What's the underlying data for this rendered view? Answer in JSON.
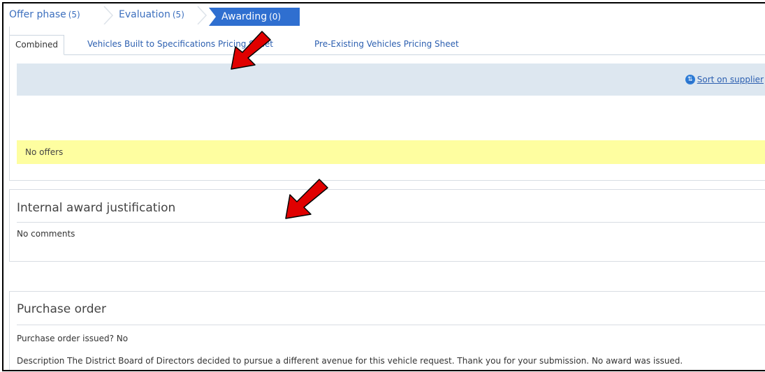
{
  "phases": [
    {
      "label": "Offer phase",
      "count": "(5)"
    },
    {
      "label": "Evaluation",
      "count": "(5)"
    },
    {
      "label": "Awarding",
      "count": "(0)"
    }
  ],
  "tabs": [
    {
      "label": "Combined"
    },
    {
      "label": "Vehicles Built to Specifications Pricing Sheet"
    },
    {
      "label": "Pre-Existing Vehicles Pricing Sheet"
    }
  ],
  "sort": {
    "label": "Sort on supplier",
    "icon": "sort-circle-icon"
  },
  "offers": {
    "empty_text": "No offers"
  },
  "justification": {
    "title": "Internal award justification",
    "comments": "No comments"
  },
  "purchase_order": {
    "title": "Purchase order",
    "issued_line": "Purchase order issued? No",
    "description_line": "Description The District Board of Directors decided to pursue a different avenue for this vehicle request. Thank you for your submission. No award was issued."
  },
  "colors": {
    "accent": "#2f6fd0",
    "link": "#2c5fb0",
    "highlight": "#fefea0",
    "arrow": "#e00000"
  }
}
